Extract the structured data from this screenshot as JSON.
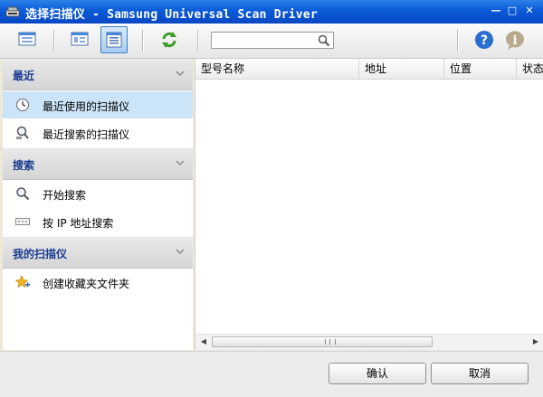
{
  "window": {
    "title": "选择扫描仪 - Samsung Universal Scan Driver",
    "minimize_glyph": "—",
    "maximize_glyph": "□",
    "close_glyph": "✕"
  },
  "toolbar": {
    "search": {
      "value": "",
      "placeholder": ""
    }
  },
  "sidebar": {
    "sections": [
      {
        "title": "最近",
        "items": [
          {
            "label": "最近使用的扫描仪",
            "icon": "clock-icon",
            "selected": true
          },
          {
            "label": "最近搜索的扫描仪",
            "icon": "search-history-icon",
            "selected": false
          }
        ]
      },
      {
        "title": "搜索",
        "items": [
          {
            "label": "开始搜索",
            "icon": "magnifier-icon",
            "selected": false
          },
          {
            "label": "按 IP 地址搜索",
            "icon": "ip-address-icon",
            "selected": false
          }
        ]
      },
      {
        "title": "我的扫描仪",
        "items": [
          {
            "label": "创建收藏夹文件夹",
            "icon": "add-favorite-icon",
            "selected": false
          }
        ]
      }
    ]
  },
  "table": {
    "columns": [
      "型号名称",
      "地址",
      "位置",
      "状态"
    ],
    "rows": []
  },
  "buttons": {
    "ok": "确认",
    "cancel": "取消"
  },
  "colors": {
    "titlebar": "#0a5ad7",
    "section_title": "#1a3b8f",
    "selection": "#cce4f7"
  }
}
